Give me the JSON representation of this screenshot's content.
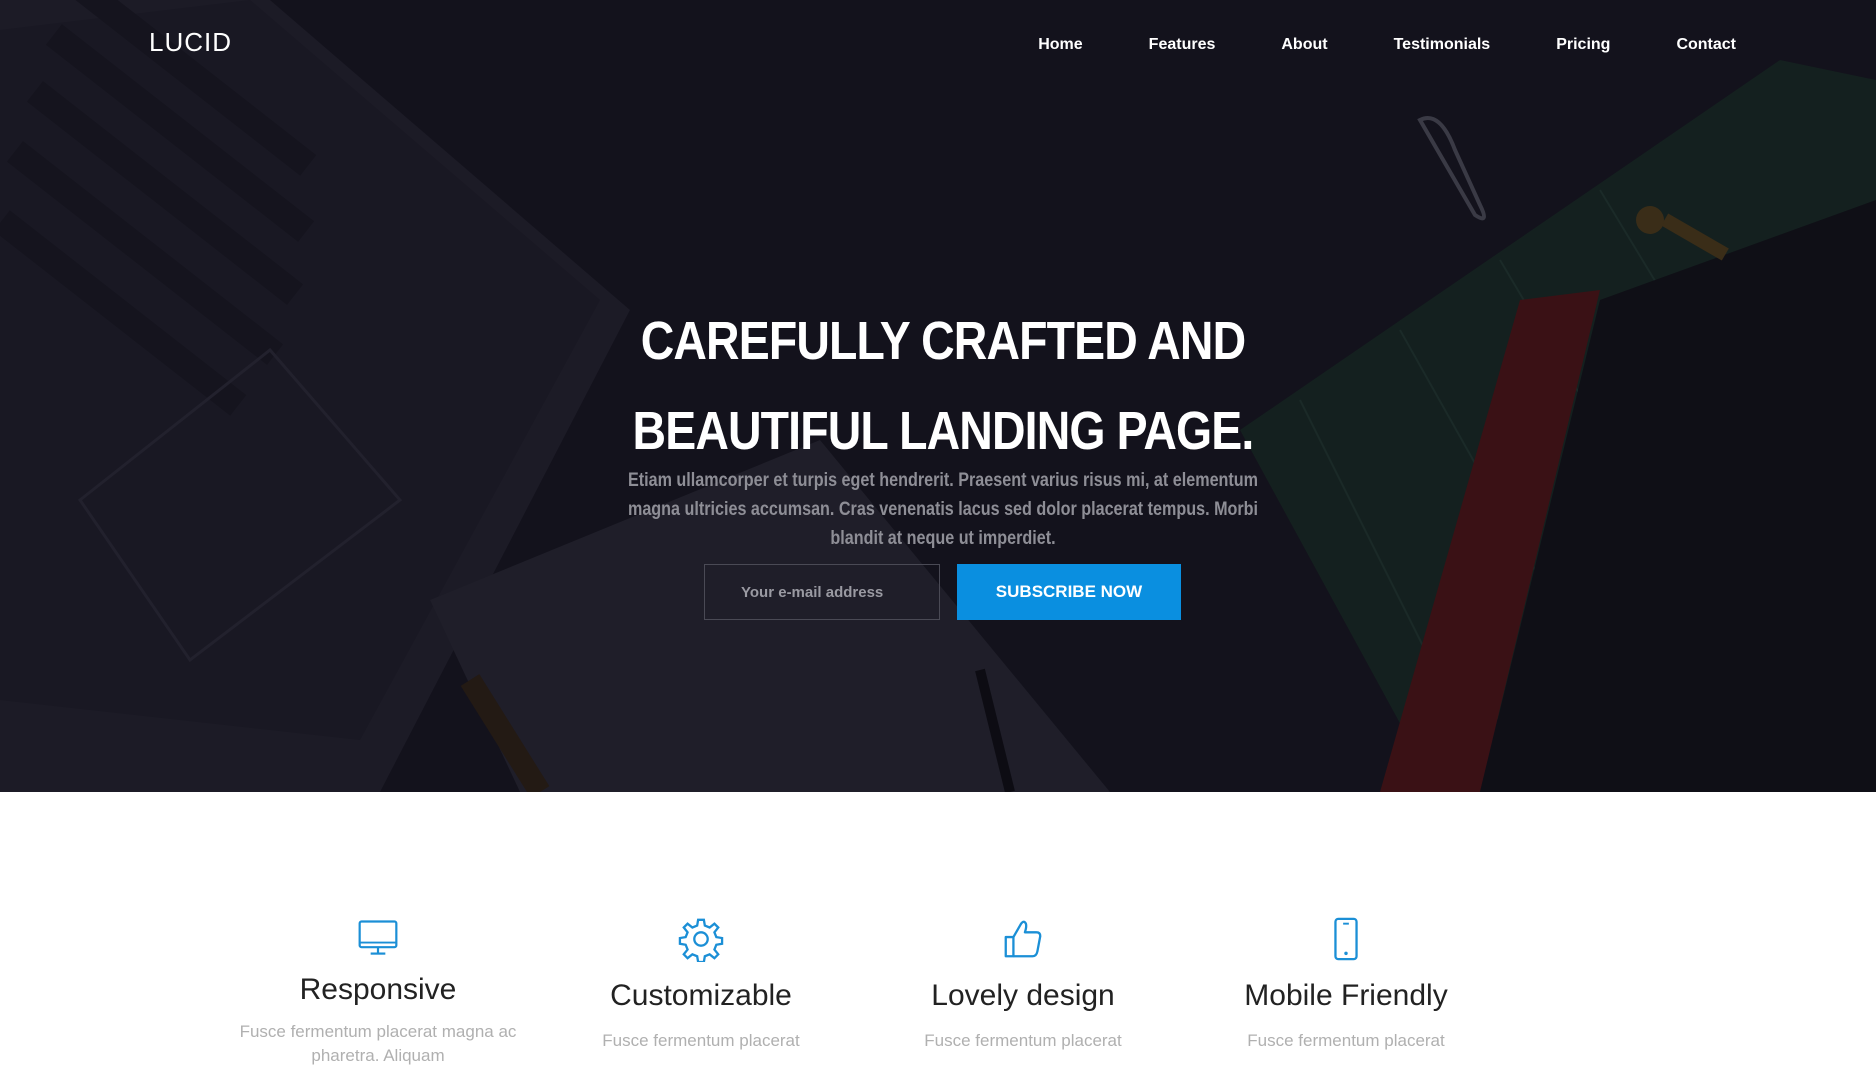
{
  "header": {
    "logo": "LUCID",
    "nav": [
      "Home",
      "Features",
      "About",
      "Testimonials",
      "Pricing",
      "Contact"
    ]
  },
  "hero": {
    "title_line1": "CAREFULLY CRAFTED AND",
    "title_line2": "BEAUTIFUL LANDING PAGE.",
    "subtitle": "Etiam ullamcorper et turpis eget hendrerit. Praesent varius risus mi, at elementum magna ultricies accumsan. Cras venenatis lacus sed dolor placerat tempus. Morbi blandit at neque ut imperdiet.",
    "email_placeholder": "Your e-mail address",
    "subscribe_label": "SUBSCRIBE NOW"
  },
  "features": [
    {
      "icon": "monitor-icon",
      "title": "Responsive",
      "text": "Fusce fermentum placerat magna ac pharetra. Aliquam"
    },
    {
      "icon": "gear-icon",
      "title": "Customizable",
      "text": "Fusce fermentum placerat"
    },
    {
      "icon": "thumbs-up-icon",
      "title": "Lovely design",
      "text": "Fusce fermentum placerat"
    },
    {
      "icon": "smartphone-icon",
      "title": "Mobile Friendly",
      "text": "Fusce fermentum placerat"
    }
  ],
  "colors": {
    "accent": "#0a8fe0",
    "hero_bg": "#13121c",
    "icon": "#1b8fd6"
  }
}
